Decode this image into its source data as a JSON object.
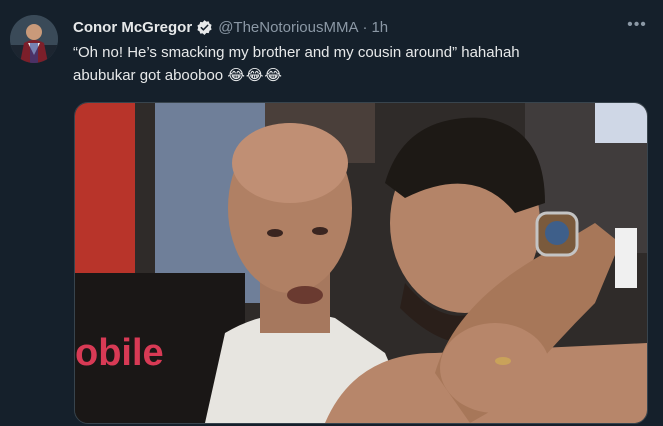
{
  "tweet": {
    "author": {
      "display_name": "Conor McGregor",
      "handle": "@TheNotoriousMMA",
      "verified": true,
      "verified_icon": "verified-badge-icon",
      "avatar_icon": "avatar"
    },
    "separator": "·",
    "timestamp": "1h",
    "more_icon": "more-options-icon",
    "more_glyph": "•••",
    "text_line1": "“Oh no! He’s smacking my brother and my cousin around” hahahah",
    "text_line2": "abubukar got abooboo",
    "emojis": "😂😂😂",
    "media": {
      "type": "photo",
      "banner_text": "obile"
    }
  },
  "colors": {
    "background": "#15202b",
    "text_primary": "#e7e9ea",
    "text_secondary": "#8b98a5",
    "verified_blue": "#1d9bf0"
  }
}
